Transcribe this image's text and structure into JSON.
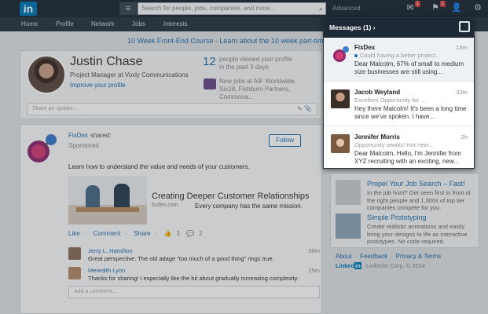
{
  "topbar": {
    "logo": "in",
    "search_placeholder": "Search for people, jobs, companies, and more...",
    "advanced": "Advanced",
    "messages_badge": "1",
    "notifications_badge": "1"
  },
  "nav": {
    "items": [
      "Home",
      "Profile",
      "Network",
      "Jobs",
      "Interests"
    ]
  },
  "banner": "10 Week Front-End Course - Learn about the 10 week part-time Front-End",
  "profile": {
    "name": "Justin Chase",
    "title": "Project Manager at Voxly Communications",
    "improve": "Improve your profile"
  },
  "stats": {
    "viewers_count": "12",
    "viewers_text": "people viewed your profile in the past 3 days",
    "jobs_text": "New jobs at AIF Worldwide, Six28, Fishburn Partners, Commona..."
  },
  "update_placeholder": "Share an update...",
  "post": {
    "author": "FixDex",
    "shared": "shared:",
    "sponsored": "Sponsored",
    "follow": "Follow",
    "text": "Learn how to understand the value and needs of your customers.",
    "link_title": "Creating Deeper Customer Relationships",
    "link_domain": "fixdex.com",
    "link_desc": "Every company has the same mission.",
    "actions": {
      "like": "Like",
      "comment": "Comment",
      "share": "Share",
      "likes_count": "3",
      "comments_count": "2"
    }
  },
  "comments": [
    {
      "name": "Jerry L. Hamilton",
      "text": "Great perspective. The old adage \"too much of a good thing\" rings true.",
      "time": "36m"
    },
    {
      "name": "Meredith Lyon",
      "text": "Thanks for sharing! I especially like the bit about gradually increasing complexity.",
      "time": "25m"
    }
  ],
  "add_comment": "Add a comment...",
  "ads": [
    {
      "title": "Propel Your Job Search – Fast!",
      "desc": "In the job hunt? Get seen first in front of the right people and 1,000s of top tier companies compete for you."
    },
    {
      "title": "Simple Prototyping",
      "desc": "Create realistic animations and easily bring your designs to life as interactive prototypes. No code required."
    }
  ],
  "footer": {
    "links": [
      "About",
      "Feedback",
      "Privacy & Terms"
    ],
    "brand": "Linked",
    "brand_in": "in",
    "copyright": "LinkedIn Corp. © 2014"
  },
  "messages": {
    "header": "Messages (1)",
    "items": [
      {
        "name": "FixDex",
        "time": "15m",
        "sub": "Could having a better project...",
        "body": "Dear Malcolm, 67% of small to medium size businesses are still using..."
      },
      {
        "name": "Jacob Weyland",
        "time": "32m",
        "sub": "Excellent Opportunity for ...",
        "body": "Hey there Malcolm! It's been a long time since we've spoken. I have..."
      },
      {
        "name": "Jennifer Morris",
        "time": "2h",
        "sub": "Opportunity awaits! Hot new...",
        "body": "Dear Malcolm, Hello, I'm Jennifer from XYZ recruiting with an exciting, new..."
      }
    ]
  },
  "colors": {
    "brand_blue": "#0077b5",
    "topbar": "#1d2a35",
    "badge_red": "#d0423d"
  }
}
